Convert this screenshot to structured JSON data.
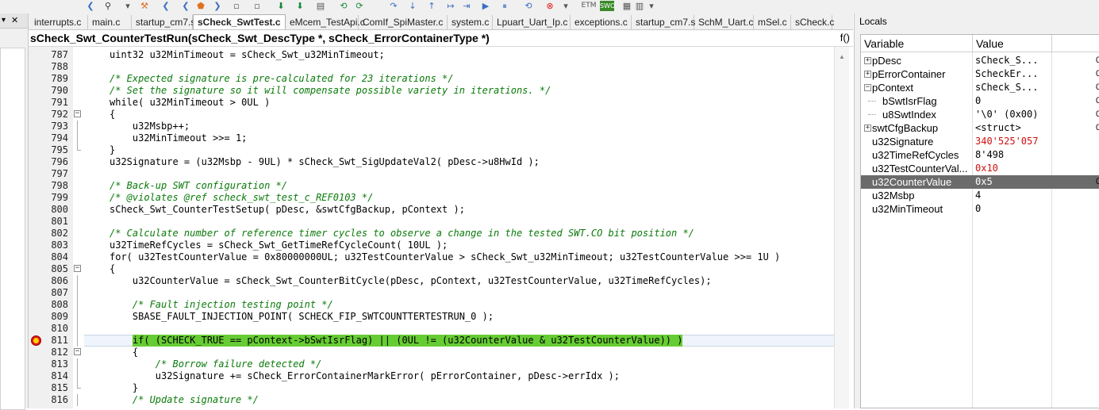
{
  "tabs": [
    {
      "label": "interrupts.c",
      "active": false
    },
    {
      "label": "main.c",
      "active": false
    },
    {
      "label": "startup_cm7.s",
      "active": false
    },
    {
      "label": "sCheck_SwtTest.c",
      "active": true
    },
    {
      "label": "eMcem_TestApi.c",
      "active": false
    },
    {
      "label": "ComIf_SpiMaster.c",
      "active": false
    },
    {
      "label": "system.c",
      "active": false
    },
    {
      "label": "Lpuart_Uart_Ip.c",
      "active": false
    },
    {
      "label": "exceptions.c",
      "active": false
    },
    {
      "label": "startup_cm7.s",
      "active": false
    },
    {
      "label": "SchM_Uart.c",
      "active": false
    },
    {
      "label": "mSel.c",
      "active": false
    },
    {
      "label": "sCheck.c",
      "active": false
    }
  ],
  "toolbar": {
    "etm_label": "ETM",
    "swo_label": "SWO"
  },
  "left_panel": {
    "close_icon": "✕"
  },
  "function_header": {
    "signature": "sCheck_Swt_CounterTestRun(sCheck_Swt_DescType *, sCheck_ErrorContainerType *)",
    "icon": "f()"
  },
  "editor": {
    "lines": [
      {
        "num": "787",
        "text": "uint32 u32MinTimeout = sCheck_Swt_u32MinTimeout;",
        "comment": false,
        "fold": "none"
      },
      {
        "num": "788",
        "text": "",
        "comment": false,
        "fold": "none"
      },
      {
        "num": "789",
        "text": "/* Expected signature is pre-calculated for 23 iterations */",
        "comment": true,
        "fold": "none"
      },
      {
        "num": "790",
        "text": "/* Set the signature so it will compensate possible variety in iterations. */",
        "comment": true,
        "fold": "none"
      },
      {
        "num": "791",
        "text": "while( u32MinTimeout > 0UL )",
        "comment": false,
        "fold": "none"
      },
      {
        "num": "792",
        "text": "{",
        "comment": false,
        "fold": "open"
      },
      {
        "num": "793",
        "text": "    u32Msbp++;",
        "comment": false,
        "fold": "line"
      },
      {
        "num": "794",
        "text": "    u32MinTimeout >>= 1;",
        "comment": false,
        "fold": "line"
      },
      {
        "num": "795",
        "text": "}",
        "comment": false,
        "fold": "end"
      },
      {
        "num": "796",
        "text": "u32Signature = (u32Msbp - 9UL) * sCheck_Swt_SigUpdateVal2( pDesc->u8HwId );",
        "comment": false,
        "fold": "none"
      },
      {
        "num": "797",
        "text": "",
        "comment": false,
        "fold": "none"
      },
      {
        "num": "798",
        "text": "/* Back-up SWT configuration */",
        "comment": true,
        "fold": "none"
      },
      {
        "num": "799",
        "text": "/* @violates @ref scheck_swt_test_c_REF0103 */",
        "comment": true,
        "fold": "none"
      },
      {
        "num": "800",
        "text": "sCheck_Swt_CounterTestSetup( pDesc, &swtCfgBackup, pContext );",
        "comment": false,
        "fold": "none"
      },
      {
        "num": "801",
        "text": "",
        "comment": false,
        "fold": "none"
      },
      {
        "num": "802",
        "text": "/* Calculate number of reference timer cycles to observe a change in the tested SWT.CO bit position */",
        "comment": true,
        "fold": "none"
      },
      {
        "num": "803",
        "text": "u32TimeRefCycles = sCheck_Swt_GetTimeRefCycleCount( 10UL );",
        "comment": false,
        "fold": "none"
      },
      {
        "num": "804",
        "text": "for( u32TestCounterValue = 0x80000000UL; u32TestCounterValue > sCheck_Swt_u32MinTimeout; u32TestCounterValue >>= 1U )",
        "comment": false,
        "fold": "none"
      },
      {
        "num": "805",
        "text": "{",
        "comment": false,
        "fold": "open"
      },
      {
        "num": "806",
        "text": "    u32CounterValue = sCheck_Swt_CounterBitCycle(pDesc, pContext, u32TestCounterValue, u32TimeRefCycles);",
        "comment": false,
        "fold": "line"
      },
      {
        "num": "807",
        "text": "",
        "comment": false,
        "fold": "line"
      },
      {
        "num": "808",
        "text": "    /* Fault injection testing point */",
        "comment": true,
        "fold": "line"
      },
      {
        "num": "809",
        "text": "    SBASE_FAULT_INJECTION_POINT( SCHECK_FIP_SWTCOUNTTERTESTRUN_0 );",
        "comment": false,
        "fold": "line"
      },
      {
        "num": "810",
        "text": "",
        "comment": false,
        "fold": "line"
      },
      {
        "num": "811",
        "text": "    if( (SCHECK_TRUE == pContext->bSwtIsrFlag) || (0UL != (u32CounterValue & u32TestCounterValue)) )",
        "comment": false,
        "fold": "line",
        "current": true
      },
      {
        "num": "812",
        "text": "    {",
        "comment": false,
        "fold": "open"
      },
      {
        "num": "813",
        "text": "        /* Borrow failure detected */",
        "comment": true,
        "fold": "line"
      },
      {
        "num": "814",
        "text": "        u32Signature += sCheck_ErrorContainerMarkError( pErrorContainer, pDesc->errIdx );",
        "comment": false,
        "fold": "line"
      },
      {
        "num": "815",
        "text": "    }",
        "comment": false,
        "fold": "end"
      },
      {
        "num": "816",
        "text": "    /* Update signature */",
        "comment": true,
        "fold": "line"
      }
    ]
  },
  "locals": {
    "title": "Locals",
    "col_variable": "Variable",
    "col_value": "Value",
    "rows": [
      {
        "name": "pDesc",
        "value": "sCheck_S...",
        "expand": "+",
        "indent": 0,
        "red": false,
        "selected": false,
        "edge": "0"
      },
      {
        "name": "pErrorContainer",
        "value": "ScheckEr...",
        "expand": "+",
        "indent": 0,
        "red": false,
        "selected": false,
        "edge": "0"
      },
      {
        "name": "pContext",
        "value": "sCheck_S...",
        "expand": "-",
        "indent": 0,
        "red": false,
        "selected": false,
        "edge": "0"
      },
      {
        "name": "bSwtIsrFlag",
        "value": "0",
        "expand": "",
        "indent": 1,
        "red": false,
        "selected": false,
        "edge": "0"
      },
      {
        "name": "u8SwtIndex",
        "value": "'\\0' (0x00)",
        "expand": "",
        "indent": 1,
        "red": false,
        "selected": false,
        "edge": "0"
      },
      {
        "name": "swtCfgBackup",
        "value": "<struct>",
        "expand": "+",
        "indent": 0,
        "red": false,
        "selected": false,
        "edge": "0"
      },
      {
        "name": "u32Signature",
        "value": "340'525'057",
        "expand": "",
        "indent": 0,
        "red": true,
        "selected": false,
        "edge": ""
      },
      {
        "name": "u32TimeRefCycles",
        "value": "8'498",
        "expand": "",
        "indent": 0,
        "red": false,
        "selected": false,
        "edge": ""
      },
      {
        "name": "u32TestCounterVal...",
        "value": "0x10",
        "expand": "",
        "indent": 0,
        "red": true,
        "selected": false,
        "edge": ""
      },
      {
        "name": "u32CounterValue",
        "value": "0x5",
        "expand": "",
        "indent": 0,
        "red": false,
        "selected": true,
        "edge": "0"
      },
      {
        "name": "u32Msbp",
        "value": "4",
        "expand": "",
        "indent": 0,
        "red": false,
        "selected": false,
        "edge": ""
      },
      {
        "name": "u32MinTimeout",
        "value": "0",
        "expand": "",
        "indent": 0,
        "red": false,
        "selected": false,
        "edge": ""
      }
    ]
  }
}
